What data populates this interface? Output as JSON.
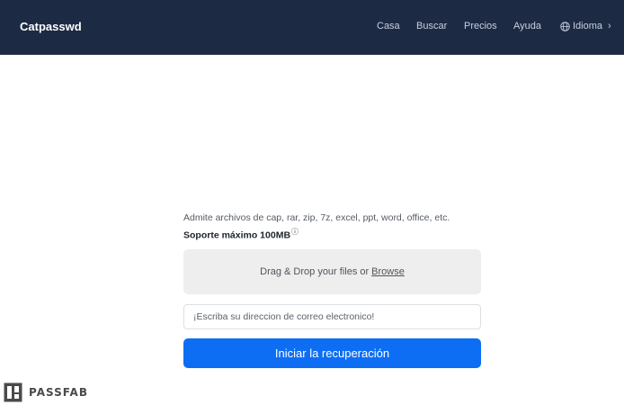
{
  "header": {
    "brand": "Catpasswd",
    "nav": {
      "casa": "Casa",
      "buscar": "Buscar",
      "precios": "Precios",
      "ayuda": "Ayuda",
      "idioma": "Idioma"
    },
    "icons": {
      "language": "globe-icon",
      "chevron": "chevron-right-icon"
    },
    "background": "#1d2a44"
  },
  "upload": {
    "supports_text": "Admite archivos de cap, rar, zip, 7z, excel, ppt, word, office, etc.",
    "max_size_text": "Soporte máximo 100MB",
    "info_icon": "info-icon",
    "dropzone_text": "Drag & Drop your files or",
    "browse_label": "Browse",
    "email_placeholder": "¡Escriba su direccion de correo electronico!",
    "start_button": "Iniciar la recuperación",
    "accent": "#0d6ef4"
  },
  "watermark": {
    "text": "PASSFAB",
    "logo_icon": "passfab-logo-icon"
  }
}
